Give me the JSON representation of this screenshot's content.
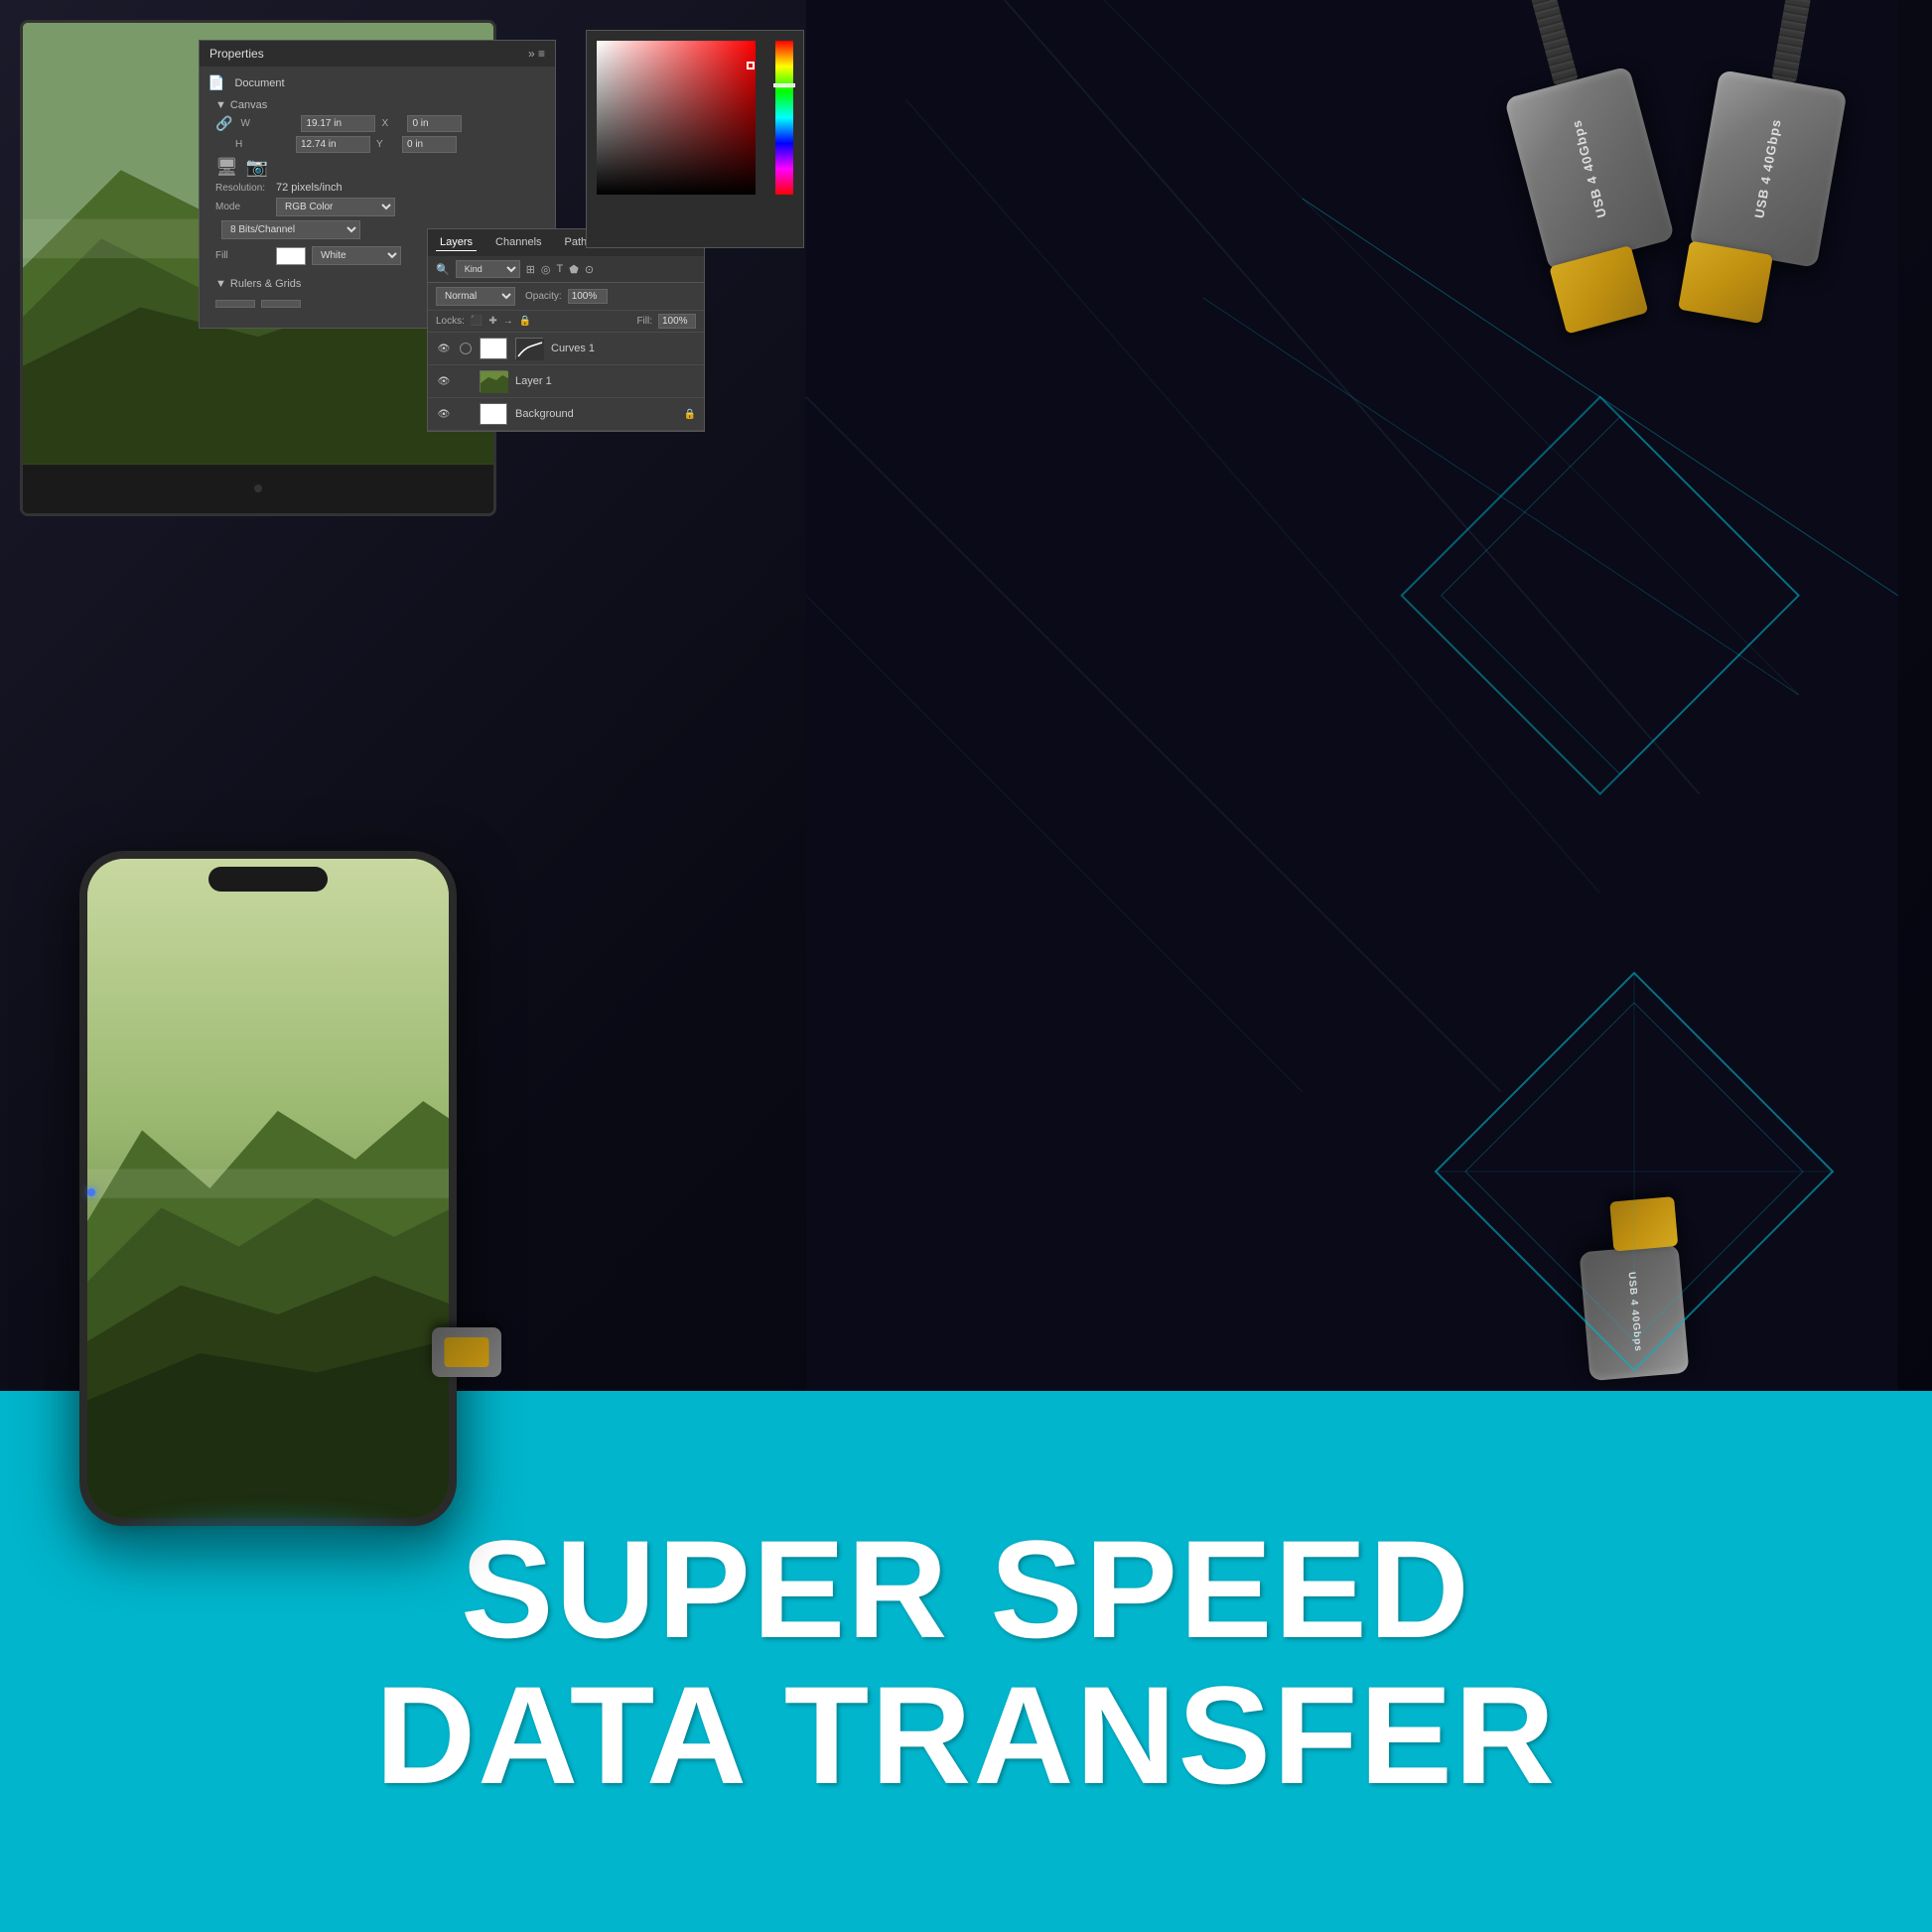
{
  "page": {
    "background_top": "#0d0d1a",
    "background_bottom": "#00b5cc"
  },
  "hero": {
    "line1": "SUPER SPEED",
    "line2": "DATA TRANSFER"
  },
  "photoshop": {
    "panel_title": "Properties",
    "document_label": "Document",
    "canvas_label": "Canvas",
    "width_label": "W",
    "height_label": "H",
    "width_value": "19.17 in",
    "height_value": "12.74 in",
    "x_label": "X",
    "y_label": "Y",
    "x_value": "0 in",
    "y_value": "0 in",
    "resolution_label": "Resolution:",
    "resolution_value": "72 pixels/inch",
    "mode_label": "Mode",
    "mode_value": "RGB Color",
    "bit_depth_value": "8 Bits/Channel",
    "fill_label": "Fill",
    "fill_value": "White",
    "rulers_label": "Rulers & Grids"
  },
  "layers": {
    "tab_layers": "Layers",
    "tab_channels": "Channels",
    "tab_paths": "Paths",
    "kind_label": "Kind",
    "mode_label": "Normal",
    "opacity_label": "Opacity:",
    "opacity_value": "100%",
    "fill_label": "Fill:",
    "fill_value": "100%",
    "layer1": {
      "name": "Curves 1",
      "type": "curves_adjustment"
    },
    "layer2": {
      "name": "Layer 1",
      "type": "raster"
    },
    "layer3": {
      "name": "Background",
      "type": "background",
      "locked": true
    }
  },
  "usb": {
    "connector1_label": "USB 4\n40Gbps",
    "connector2_label": "USB 4\n40Gbps",
    "connector3_label": "USB 4\n40Gbps"
  }
}
